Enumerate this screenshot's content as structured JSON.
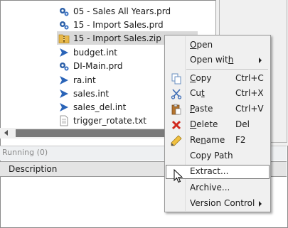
{
  "files": [
    {
      "name": "05 - Sales All Years.prd",
      "icon": "gear-report-icon"
    },
    {
      "name": "15 - Import Sales.prd",
      "icon": "gear-report-icon"
    },
    {
      "name": "15 - Import Sales.zip",
      "icon": "zip-folder-icon",
      "selected": true
    },
    {
      "name": "budget.int",
      "icon": "blue-flag-icon"
    },
    {
      "name": "DI-Main.prd",
      "icon": "gear-report-icon"
    },
    {
      "name": "ra.int",
      "icon": "blue-flag-icon"
    },
    {
      "name": "sales.int",
      "icon": "blue-flag-icon"
    },
    {
      "name": "sales_del.int",
      "icon": "blue-flag-icon"
    },
    {
      "name": "trigger_rotate.txt",
      "icon": "text-file-icon"
    }
  ],
  "running": {
    "label": "Running (0)"
  },
  "table": {
    "column_description": "Description"
  },
  "context_menu": {
    "open": {
      "pre": "",
      "ul": "O",
      "post": "pen"
    },
    "open_with": {
      "pre": "Open wit",
      "ul": "h",
      "post": ""
    },
    "copy": {
      "pre": "",
      "ul": "C",
      "post": "opy",
      "shortcut": "Ctrl+C"
    },
    "cut": {
      "pre": "Cu",
      "ul": "t",
      "post": "",
      "shortcut": "Ctrl+X"
    },
    "paste": {
      "pre": "",
      "ul": "P",
      "post": "aste",
      "shortcut": "Ctrl+V"
    },
    "delete": {
      "pre": "",
      "ul": "D",
      "post": "elete",
      "shortcut": "Del"
    },
    "rename": {
      "pre": "Re",
      "ul": "n",
      "post": "ame",
      "shortcut": "F2"
    },
    "copy_path": {
      "label": "Copy Path"
    },
    "extract": {
      "label": "Extract..."
    },
    "archive": {
      "label": "Archive..."
    },
    "version_control": {
      "label": "Version Control"
    }
  }
}
